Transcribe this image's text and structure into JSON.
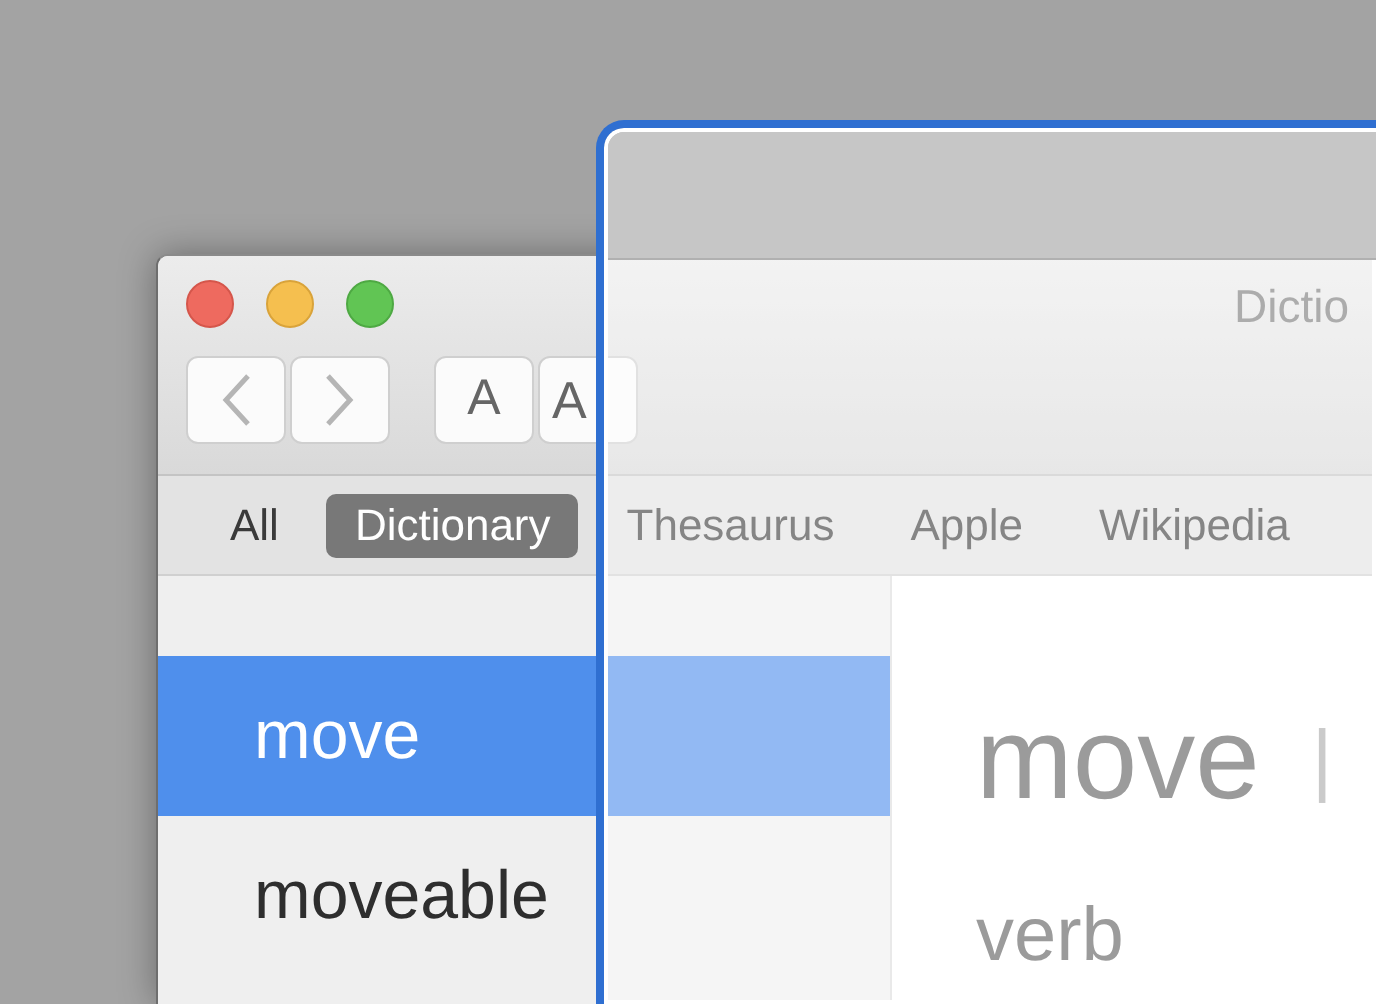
{
  "window": {
    "title": "Dictio"
  },
  "toolbar": {
    "font_buttons": [
      "A",
      "A"
    ]
  },
  "tabs": [
    {
      "label": "All",
      "selected": false
    },
    {
      "label": "Dictionary",
      "selected": true
    },
    {
      "label": "Thesaurus",
      "selected": false
    },
    {
      "label": "Apple",
      "selected": false
    },
    {
      "label": "Wikipedia",
      "selected": false
    }
  ],
  "sidebar": {
    "items": [
      {
        "label": "move",
        "selected": true
      },
      {
        "label": "moveable",
        "selected": false
      }
    ]
  },
  "entry": {
    "headword": "move",
    "separator": "|",
    "part_of_speech": "verb"
  }
}
